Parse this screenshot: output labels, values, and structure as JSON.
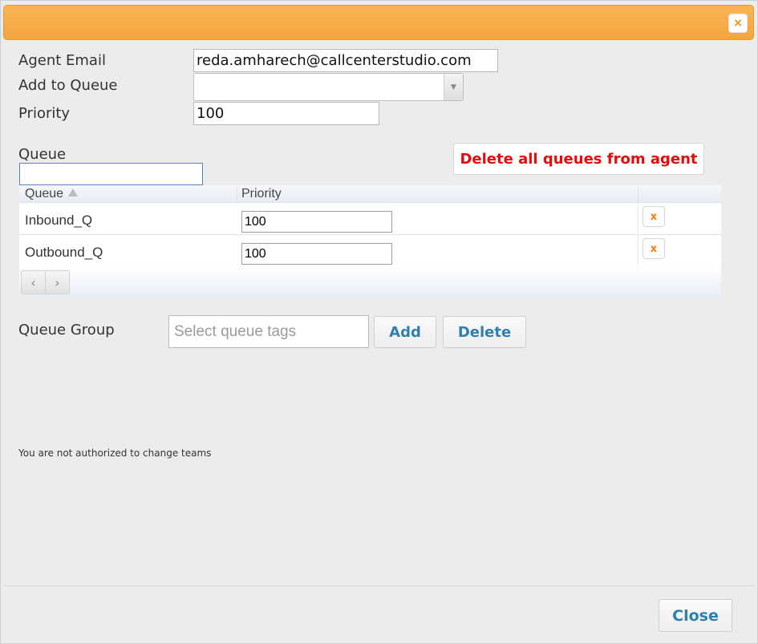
{
  "dialog": {
    "close_glyph": "×",
    "close_icon": "close-icon"
  },
  "form": {
    "agent_email_label": "Agent Email",
    "agent_email_value": "reda.amharech@callcenterstudio.com",
    "add_to_queue_label": "Add to Queue",
    "add_to_queue_value": "",
    "priority_label": "Priority",
    "priority_value": "100"
  },
  "queue_filter": {
    "label": "Queue",
    "value": ""
  },
  "delete_all_button": "Delete all queues from agent",
  "grid": {
    "headers": {
      "queue": "Queue",
      "priority": "Priority"
    },
    "sort": "ascending",
    "rows": [
      {
        "queue": "Inbound_Q",
        "priority": "100",
        "remove_glyph": "x"
      },
      {
        "queue": "Outbound_Q",
        "priority": "100",
        "remove_glyph": "x"
      }
    ],
    "pager": {
      "prev_glyph": "‹",
      "next_glyph": "›"
    }
  },
  "queue_group": {
    "label": "Queue Group",
    "placeholder": "Select queue tags",
    "add_label": "Add",
    "delete_label": "Delete"
  },
  "notice": "You are not authorized to change teams",
  "footer": {
    "close_label": "Close"
  },
  "colors": {
    "titlebar": "#f5a843",
    "danger_text": "#e60b0b",
    "link_blue": "#2f7fad",
    "remove_icon": "#ef7d0b"
  }
}
